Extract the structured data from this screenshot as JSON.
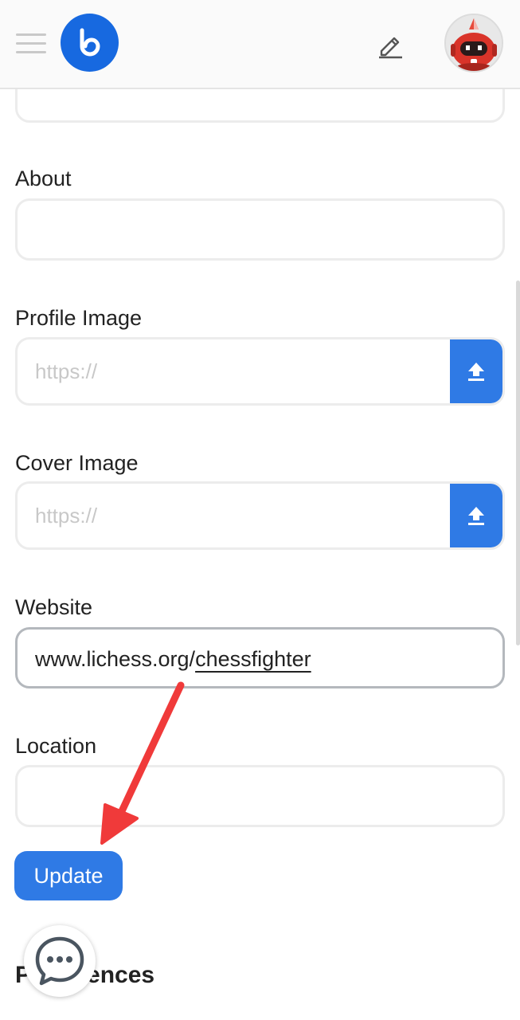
{
  "header": {
    "menu_icon": "hamburger-icon",
    "logo_icon": "brand-logo-icon",
    "edit_icon": "pencil-icon",
    "avatar_icon": "robot-avatar"
  },
  "form": {
    "about_label": "About",
    "profile_image_label": "Profile Image",
    "profile_image_placeholder": "https://",
    "cover_image_label": "Cover Image",
    "cover_image_placeholder": "https://",
    "upload_icon": "upload-icon",
    "website_label": "Website",
    "website_value_prefix": "www.lichess.org/",
    "website_value_link": "chessfighter",
    "location_label": "Location",
    "update_label": "Update"
  },
  "preferences_heading_left": "P",
  "preferences_heading_right": "ences",
  "chat_icon": "chat-bubble-icon",
  "colors": {
    "accent": "#2f7ae5",
    "brand": "#1769e0",
    "annotation_arrow": "#f03a3a"
  }
}
